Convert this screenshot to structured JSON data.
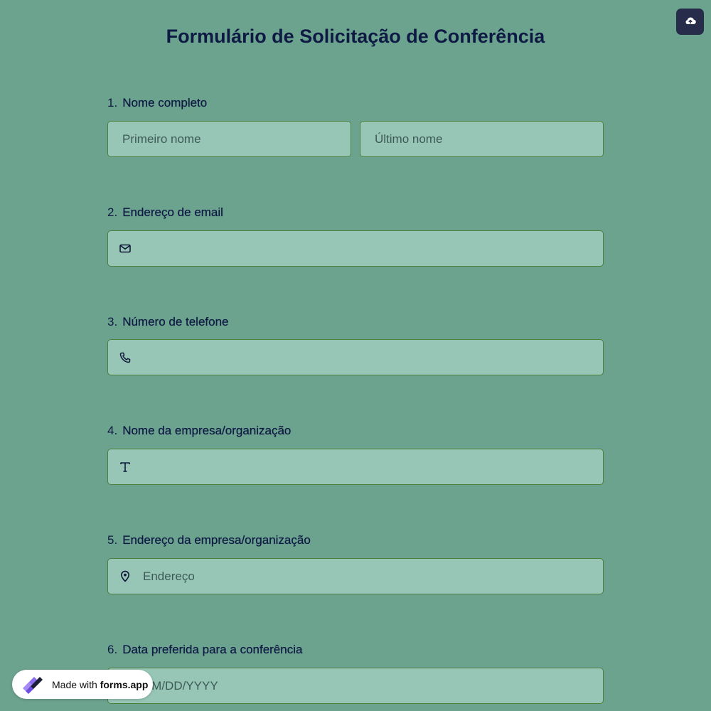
{
  "form": {
    "title": "Formulário de Solicitação de Conferência",
    "questions": [
      {
        "number": "1.",
        "label": "Nome completo",
        "first_placeholder": "Primeiro nome",
        "last_placeholder": "Último nome"
      },
      {
        "number": "2.",
        "label": "Endereço de email",
        "icon": "mail-icon",
        "placeholder": ""
      },
      {
        "number": "3.",
        "label": "Número de telefone",
        "icon": "phone-icon",
        "placeholder": ""
      },
      {
        "number": "4.",
        "label": "Nome da empresa/organização",
        "icon": "text-t-icon",
        "placeholder": ""
      },
      {
        "number": "5.",
        "label": "Endereço da empresa/organização",
        "icon": "map-pin-icon",
        "placeholder": "Endereço"
      },
      {
        "number": "6.",
        "label": "Data preferida para a conferência",
        "placeholder": "MM/DD/YYYY"
      }
    ]
  },
  "toolbar": {
    "upload_icon": "cloud-upload-icon"
  },
  "badge": {
    "prefix": "Made with ",
    "brand": "forms.app",
    "logo": "forms-app-logo"
  },
  "colors": {
    "background": "#6ca38f",
    "field_bg": "#97c6b6",
    "field_border": "#4d7f3c",
    "title": "#0f1a44",
    "upload_button": "#272c4a"
  }
}
